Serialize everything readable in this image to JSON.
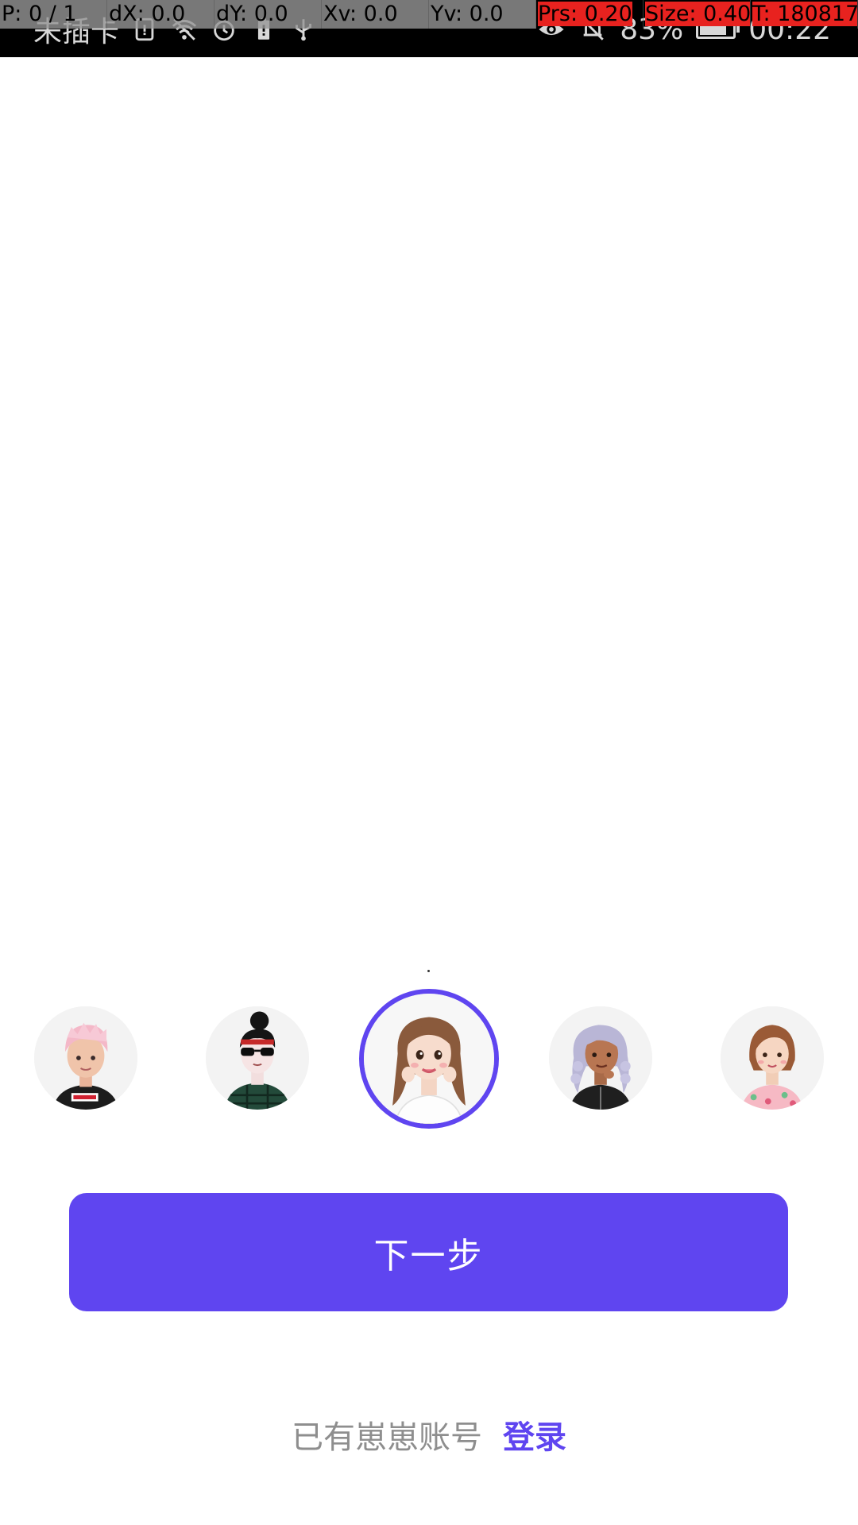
{
  "status_bar": {
    "carrier": "未插卡",
    "battery_percent": "83%",
    "battery_level": 0.83,
    "time": "00:22",
    "icons_left": [
      "sim-icon",
      "wifi-icon",
      "alarm-icon",
      "battery-saver-icon",
      "usb-icon"
    ],
    "icons_right": [
      "eye-icon",
      "mute-icon",
      "battery-icon"
    ]
  },
  "debug_overlay": {
    "pointer": "P: 0 / 1",
    "dx": "dX: 0.0",
    "dy": "dY: 0.0",
    "xv": "Xv: 0.0",
    "yv": "Yv: 0.0",
    "prs": "Prs: 0.20",
    "size": "Size: 0.40",
    "touch": "T: 180817"
  },
  "avatars": [
    {
      "name": "avatar-pink-hair-boy",
      "selected": false
    },
    {
      "name": "avatar-sunglasses-bun",
      "selected": false
    },
    {
      "name": "avatar-long-hair-girl",
      "selected": true
    },
    {
      "name": "avatar-silver-curls",
      "selected": false
    },
    {
      "name": "avatar-bob-hair-girl",
      "selected": false
    }
  ],
  "actions": {
    "next_label": "下一步"
  },
  "login": {
    "prompt": "已有崽崽账号",
    "link_label": "登录"
  },
  "colors": {
    "accent": "#5f45f0",
    "text_muted": "#8e8e8e",
    "background": "#ffffff",
    "status_bar": "#000000"
  }
}
